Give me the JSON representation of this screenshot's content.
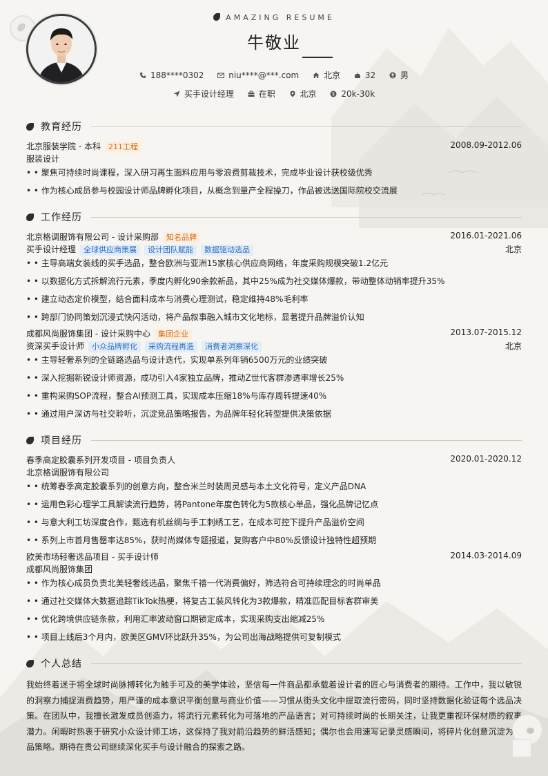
{
  "header": {
    "brand": "AMAZING RESUME",
    "name": "牛敬业",
    "row1": [
      {
        "icon": "phone-icon",
        "text": "188****0302"
      },
      {
        "icon": "mail-icon",
        "text": "niu****@***.com"
      },
      {
        "icon": "home-icon",
        "text": "北京"
      },
      {
        "icon": "cake-icon",
        "text": "32"
      },
      {
        "icon": "gender-icon",
        "text": "男"
      }
    ],
    "row2": [
      {
        "icon": "send-icon",
        "text": "买手设计经理"
      },
      {
        "icon": "briefcase-icon",
        "text": "在职"
      },
      {
        "icon": "location-icon",
        "text": "北京"
      },
      {
        "icon": "salary-icon",
        "text": "20k-30k"
      }
    ]
  },
  "sections": {
    "education": "教育经历",
    "work": "工作经历",
    "project": "项目经历",
    "summary": "个人总结"
  },
  "education": {
    "school": "北京服装学院 - 本科",
    "tag": "211工程",
    "date": "2008.09-2012.06",
    "major": "服装设计",
    "bullets": [
      "• • 聚焦可持续时尚课程，深入研习再生面料应用与零浪费剪裁技术，完成毕业设计获校级优秀",
      "• • 作为核心成员参与校园设计师品牌孵化项目，从概念到量产全程操刀，作品被选送国际院校交流展"
    ]
  },
  "work": [
    {
      "company": "北京格调服饰有限公司 - 设计采购部",
      "tag": "知名品牌",
      "date": "2016.01-2021.06",
      "role": "买手设计经理",
      "skills": [
        "全球供应商策展",
        "设计团队赋能",
        "数据驱动选品"
      ],
      "city": "北京",
      "bullets": [
        "• • 主导高端女装线的买手选品，整合欧洲与亚洲15家核心供应商网络，年度采购规模突破1.2亿元",
        "• • 以数据化方式拆解流行元素，季度内孵化90余款新品，其中25%成为社交媒体爆款，带动整体动销率提升35%",
        "• • 建立动态定价模型，结合面料成本与消费心理测试，稳定维持48%毛利率",
        "• • 跨部门协同策划沉浸式快闪活动，将产品叙事融入城市文化地标，显著提升品牌溢价认知"
      ]
    },
    {
      "company": "成都风尚服饰集团 - 设计采购中心",
      "tag": "集团企业",
      "date": "2013.07-2015.12",
      "role": "资深买手设计师",
      "skills": [
        "小众品牌孵化",
        "采购流程再造",
        "消费者洞察深化"
      ],
      "city": "北京",
      "bullets": [
        "• • 主导轻奢系列的全链路选品与设计迭代，实现单系列年销6500万元的业绩突破",
        "• • 深入挖掘新锐设计师资源，成功引入4家独立品牌，推动Z世代客群渗透率增长25%",
        "• • 重构采购SOP流程，整合AI预测工具，实现成本压缩18%与库存周转提速40%",
        "• • 通过用户深访与社交聆听，沉淀竞品策略报告，为品牌年轻化转型提供决策依据"
      ]
    }
  ],
  "projects": [
    {
      "title": "春季高定胶囊系列开发项目 - 项目负责人",
      "date": "2020.01-2020.12",
      "org": "北京格调服饰有限公司",
      "bullets": [
        "• • 统筹春季高定胶囊系列的创意方向，整合米兰时装周灵感与本土文化符号，定义产品DNA",
        "• • 运用色彩心理学工具解读流行趋势，将Pantone年度色转化为5款核心单品，强化品牌记忆点",
        "• • 与意大利工坊深度合作，甄选有机丝绸与手工刺绣工艺，在成本可控下提升产品溢价空间",
        "• • 系列上市首月售罄率达85%，获时尚媒体专题报道，复购客户中80%反馈设计独特性超预期"
      ]
    },
    {
      "title": "欧美市场轻奢选品项目 - 买手设计师",
      "date": "2014.03-2014.09",
      "org": "成都风尚服饰集团",
      "bullets": [
        "• • 作为核心成员负责北美轻奢线选品，聚焦千禧一代消费偏好，筛选符合可持续理念的时尚单品",
        "• • 通过社交媒体大数据追踪TikTok热梗，将复古工装风转化为3款爆款，精准匹配目标客群审美",
        "• • 优化跨境供应链条款，利用汇率波动窗口期锁定成本，实现采购支出缩减25%",
        "• • 项目上线后3个月内，欧美区GMV环比跃升35%，为公司出海战略提供可复制模式"
      ]
    }
  ],
  "summary": "我始终着迷于将全球时尚脉搏转化为触手可及的美学体验，坚信每一件商品都承载着设计者的匠心与消费者的期待。工作中，我以敏锐的洞察力捕捉消费趋势，用严谨的成本意识平衡创意与商业价值——习惯从街头文化中提取流行密码，同时坚持数据化验证每个选品决策。在团队中，我擅长激发成员创造力，将流行元素转化为可落地的产品语言；对可持续时尚的长期关注，让我更重视环保材质的叙事潜力。闲暇时热衷于研究小众设计师工坊，这保持了我对前沿趋势的鲜活感知；偶尔也会用速写记录灵感瞬间，将碎片化创意沉淀为选品策略。期待在贵公司继续深化买手与设计融合的探索之路。",
  "colors": {
    "accent_orange": "#d26a16",
    "accent_blue": "#2b6fc4",
    "ink": "#2d2d2d",
    "paper": "#f6f5f1"
  }
}
